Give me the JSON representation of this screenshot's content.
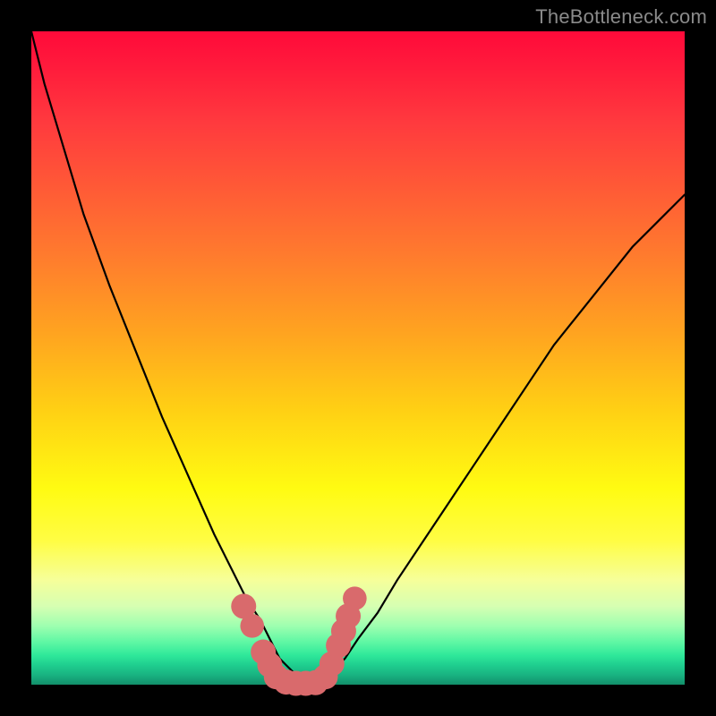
{
  "watermark": "TheBottleneck.com",
  "colors": {
    "frame": "#000000",
    "curve_stroke": "#000000",
    "marker_fill": "#d96a6c",
    "marker_stroke": "#d96a6c",
    "gradient_stops": [
      "#ff0a3a",
      "#ff1d3c",
      "#ff3a3e",
      "#ff5a36",
      "#ff7a2e",
      "#ffa320",
      "#ffd014",
      "#fffb12",
      "#fffd44",
      "#f6ff9a",
      "#d6ffb2",
      "#9effb0",
      "#5ef7a4",
      "#2fe89a",
      "#1fce8f",
      "#19b381",
      "#128f6a"
    ]
  },
  "chart_data": {
    "type": "line",
    "title": "",
    "xlabel": "",
    "ylabel": "",
    "xlim": [
      0,
      100
    ],
    "ylim": [
      0,
      100
    ],
    "grid": false,
    "legend": false,
    "comment": "Values estimated from pixel positions; y=0 at bottom (green), y=100 at top (red). Two black curves form a V with minimum near x≈37–44, y≈0. Salmon marker dots sit along the curves near the trough.",
    "series": [
      {
        "name": "left-curve",
        "x": [
          0,
          2,
          5,
          8,
          12,
          16,
          20,
          24,
          28,
          31,
          33,
          35,
          36,
          37,
          38,
          39,
          40,
          41,
          42,
          43
        ],
        "y": [
          100,
          92,
          82,
          72,
          61,
          51,
          41,
          32,
          23,
          17,
          13,
          10,
          8,
          6,
          4,
          3,
          2,
          1,
          0.5,
          0.2
        ]
      },
      {
        "name": "right-curve",
        "x": [
          44,
          45,
          46,
          48,
          50,
          53,
          56,
          60,
          64,
          68,
          72,
          76,
          80,
          84,
          88,
          92,
          96,
          100
        ],
        "y": [
          0.3,
          1,
          2,
          4,
          7,
          11,
          16,
          22,
          28,
          34,
          40,
          46,
          52,
          57,
          62,
          67,
          71,
          75
        ]
      },
      {
        "name": "bottom-flat",
        "x": [
          37,
          39,
          41,
          43,
          45
        ],
        "y": [
          0,
          0,
          0,
          0,
          0
        ]
      }
    ],
    "markers": {
      "name": "trough-dots",
      "comment": "Salmon-colored dots near the valley along both curves and the flat bottom.",
      "points": [
        {
          "x": 32.5,
          "y": 12,
          "r": 1.3
        },
        {
          "x": 33.8,
          "y": 9,
          "r": 1.0
        },
        {
          "x": 35.5,
          "y": 5,
          "r": 1.6
        },
        {
          "x": 36.5,
          "y": 3,
          "r": 1.3
        },
        {
          "x": 37.5,
          "y": 1.2,
          "r": 1.5
        },
        {
          "x": 39.0,
          "y": 0.4,
          "r": 1.6
        },
        {
          "x": 40.5,
          "y": 0.2,
          "r": 1.6
        },
        {
          "x": 42.0,
          "y": 0.2,
          "r": 1.6
        },
        {
          "x": 43.5,
          "y": 0.3,
          "r": 1.6
        },
        {
          "x": 45.0,
          "y": 1.2,
          "r": 1.5
        },
        {
          "x": 46.0,
          "y": 3.2,
          "r": 1.4
        },
        {
          "x": 47.0,
          "y": 6.0,
          "r": 1.6
        },
        {
          "x": 47.8,
          "y": 8.2,
          "r": 1.2
        },
        {
          "x": 48.5,
          "y": 10.5,
          "r": 1.5
        },
        {
          "x": 49.5,
          "y": 13.2,
          "r": 1.0
        }
      ]
    }
  }
}
